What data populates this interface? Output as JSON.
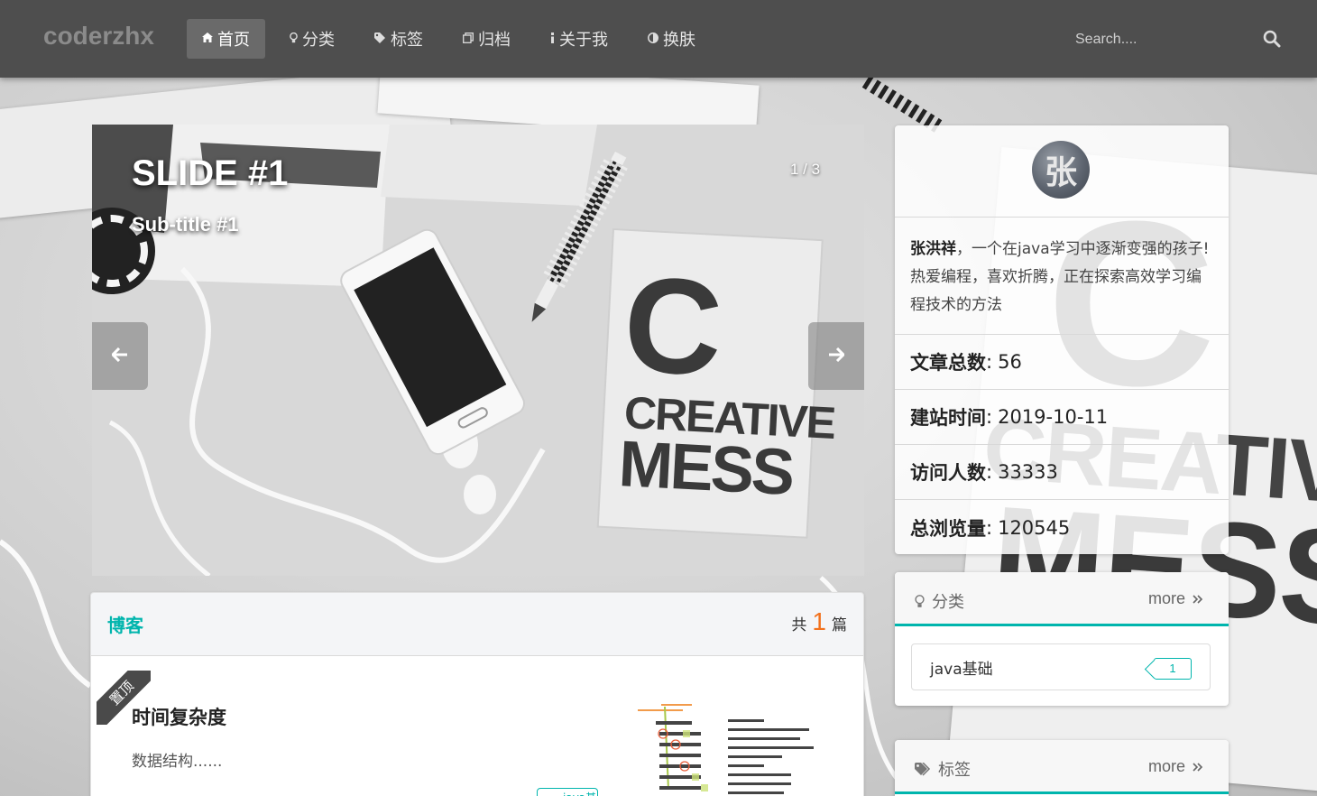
{
  "navbar": {
    "brand": "coderzhx",
    "items": [
      {
        "label": "首页",
        "icon": "home-icon",
        "active": true
      },
      {
        "label": "分类",
        "icon": "lightbulb-icon",
        "active": false
      },
      {
        "label": "标签",
        "icon": "tag-icon",
        "active": false
      },
      {
        "label": "归档",
        "icon": "clone-icon",
        "active": false
      },
      {
        "label": "关于我",
        "icon": "info-icon",
        "active": false
      },
      {
        "label": "换肤",
        "icon": "adjust-icon",
        "active": false
      }
    ],
    "search_placeholder": "Search...."
  },
  "carousel": {
    "title": "SLIDE #1",
    "subtitle": "Sub-title #1",
    "counter": "1 / 3",
    "photo_text_top": "C",
    "photo_text_mid": "CREATIVE",
    "photo_text_bottom": "MESS"
  },
  "blog": {
    "title": "博客",
    "count_prefix": "共",
    "count": "1",
    "count_suffix": "篇",
    "posts": [
      {
        "ribbon": "置顶",
        "title": "时间复杂度",
        "excerpt": "数据结构......",
        "tag": "java基础"
      }
    ]
  },
  "profile": {
    "avatar_char": "张",
    "name": "张洪祥",
    "bio": "，一个在java学习中逐渐变强的孩子!热爱编程，喜欢折腾，正在探索高效学习编程技术的方法",
    "stats": [
      {
        "label": "文章总数",
        "sep": " :",
        "value": "56"
      },
      {
        "label": "建站时间",
        "sep": ":",
        "value": "2019-10-11"
      },
      {
        "label": "访问人数",
        "sep": ":",
        "value": "33333"
      },
      {
        "label": "总浏览量",
        "sep": ":",
        "value": "120545"
      }
    ]
  },
  "categories": {
    "title": "分类",
    "more": "more",
    "items": [
      {
        "name": "java基础",
        "count": "1"
      }
    ]
  },
  "tags": {
    "title": "标签",
    "more": "more"
  },
  "colors": {
    "accent": "#00b5ad",
    "count_orange": "#f2711c",
    "navbar": "#4e4e4e"
  }
}
